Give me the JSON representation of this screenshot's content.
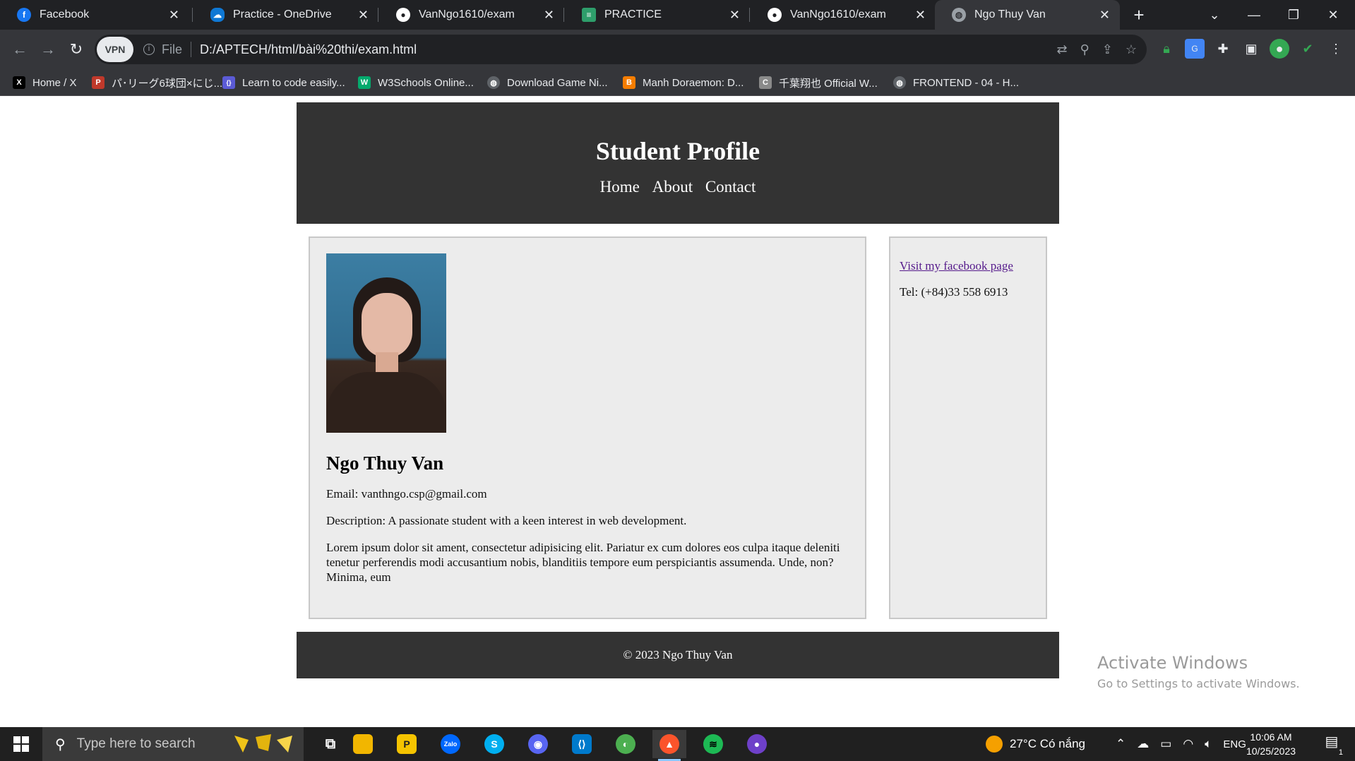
{
  "browser": {
    "tabs": [
      {
        "title": "Facebook",
        "icon": "facebook-icon",
        "color": "#1877f2",
        "glyph": "f"
      },
      {
        "title": "Practice - OneDrive",
        "icon": "onedrive-icon",
        "color": "#0f78d4",
        "glyph": "☁"
      },
      {
        "title": "VanNgo1610/exam",
        "icon": "github-icon",
        "color": "#ffffff",
        "glyph": "●"
      },
      {
        "title": "PRACTICE",
        "icon": "practice-icon",
        "color": "#2e9e6b",
        "glyph": "≡"
      },
      {
        "title": "VanNgo1610/exam",
        "icon": "github-icon",
        "color": "#ffffff",
        "glyph": "●"
      },
      {
        "title": "Ngo Thuy Van",
        "icon": "globe-icon",
        "color": "#9aa0a6",
        "glyph": "◍"
      }
    ],
    "active_tab_index": 5,
    "omnibox": {
      "vpn_label": "VPN",
      "scheme_label": "File",
      "url": "D:/APTECH/html/bài%20thi/exam.html"
    },
    "bookmarks": [
      {
        "label": "Home / X",
        "icon": "x-icon",
        "color": "#000000",
        "glyph": "X"
      },
      {
        "label": "パ･リーグ6球団×にじ...",
        "icon": "pacific-league-icon",
        "color": "#c0392b",
        "glyph": "P"
      },
      {
        "label": "Learn to code easily...",
        "icon": "code-icon",
        "color": "#5b5bd6",
        "glyph": "{}"
      },
      {
        "label": "W3Schools Online...",
        "icon": "w3schools-icon",
        "color": "#04aa6d",
        "glyph": "W"
      },
      {
        "label": "Download Game Ni...",
        "icon": "globe-icon",
        "color": "#5f6368",
        "glyph": "◍"
      },
      {
        "label": "Manh Doraemon: D...",
        "icon": "blogger-icon",
        "color": "#f57d00",
        "glyph": "B"
      },
      {
        "label": "千葉翔也 Official W...",
        "icon": "c-icon",
        "color": "#8a8a8a",
        "glyph": "C"
      },
      {
        "label": "FRONTEND - 04 - H...",
        "icon": "globe-icon",
        "color": "#5f6368",
        "glyph": "◍"
      }
    ]
  },
  "site": {
    "title": "Student Profile",
    "nav": [
      "Home",
      "About",
      "Contact"
    ],
    "profile": {
      "name": "Ngo Thuy Van",
      "email_line": "Email: vanthngo.csp@gmail.com",
      "description_line": "Description: A passionate student with a keen interest in web development.",
      "lorem": "Lorem ipsum dolor sit ament, consectetur adipisicing elit. Pariatur ex cum dolores eos culpa itaque deleniti tenetur perferendis modi accusantium nobis, blanditiis tempore eum perspiciantis assumenda. Unde, non? Minima, eum"
    },
    "sidebar": {
      "link": "Visit my facebook page",
      "tel": "Tel: (+84)33 558 6913"
    },
    "footer": "© 2023 Ngo Thuy Van"
  },
  "watermark": {
    "title": "Activate Windows",
    "subtitle": "Go to Settings to activate Windows."
  },
  "taskbar": {
    "search_placeholder": "Type here to search",
    "apps": [
      {
        "name": "task-view-icon",
        "color": "#202020",
        "glyph": "⧉"
      },
      {
        "name": "file-explorer-icon",
        "color": "#f2b600",
        "glyph": "▬"
      },
      {
        "name": "unknown-app-icon",
        "color": "#f5c400",
        "glyph": "P"
      },
      {
        "name": "zalo-icon",
        "color": "#0068ff",
        "glyph": "Zalo"
      },
      {
        "name": "skype-icon",
        "color": "#00aff0",
        "glyph": "S"
      },
      {
        "name": "discord-icon",
        "color": "#5865f2",
        "glyph": "◉"
      },
      {
        "name": "vscode-icon",
        "color": "#007acc",
        "glyph": "⟨⟩"
      },
      {
        "name": "app-green-icon",
        "color": "#4caf50",
        "glyph": "◐"
      },
      {
        "name": "brave-icon",
        "color": "#fb542b",
        "glyph": "▲"
      },
      {
        "name": "spotify-icon",
        "color": "#1db954",
        "glyph": "≋"
      },
      {
        "name": "github-desktop-icon",
        "color": "#6e40c9",
        "glyph": "●"
      }
    ],
    "weather": "27°C  Có nắng",
    "language": "ENG",
    "time": "10:06 AM",
    "date": "10/25/2023",
    "notification_count": "1"
  }
}
